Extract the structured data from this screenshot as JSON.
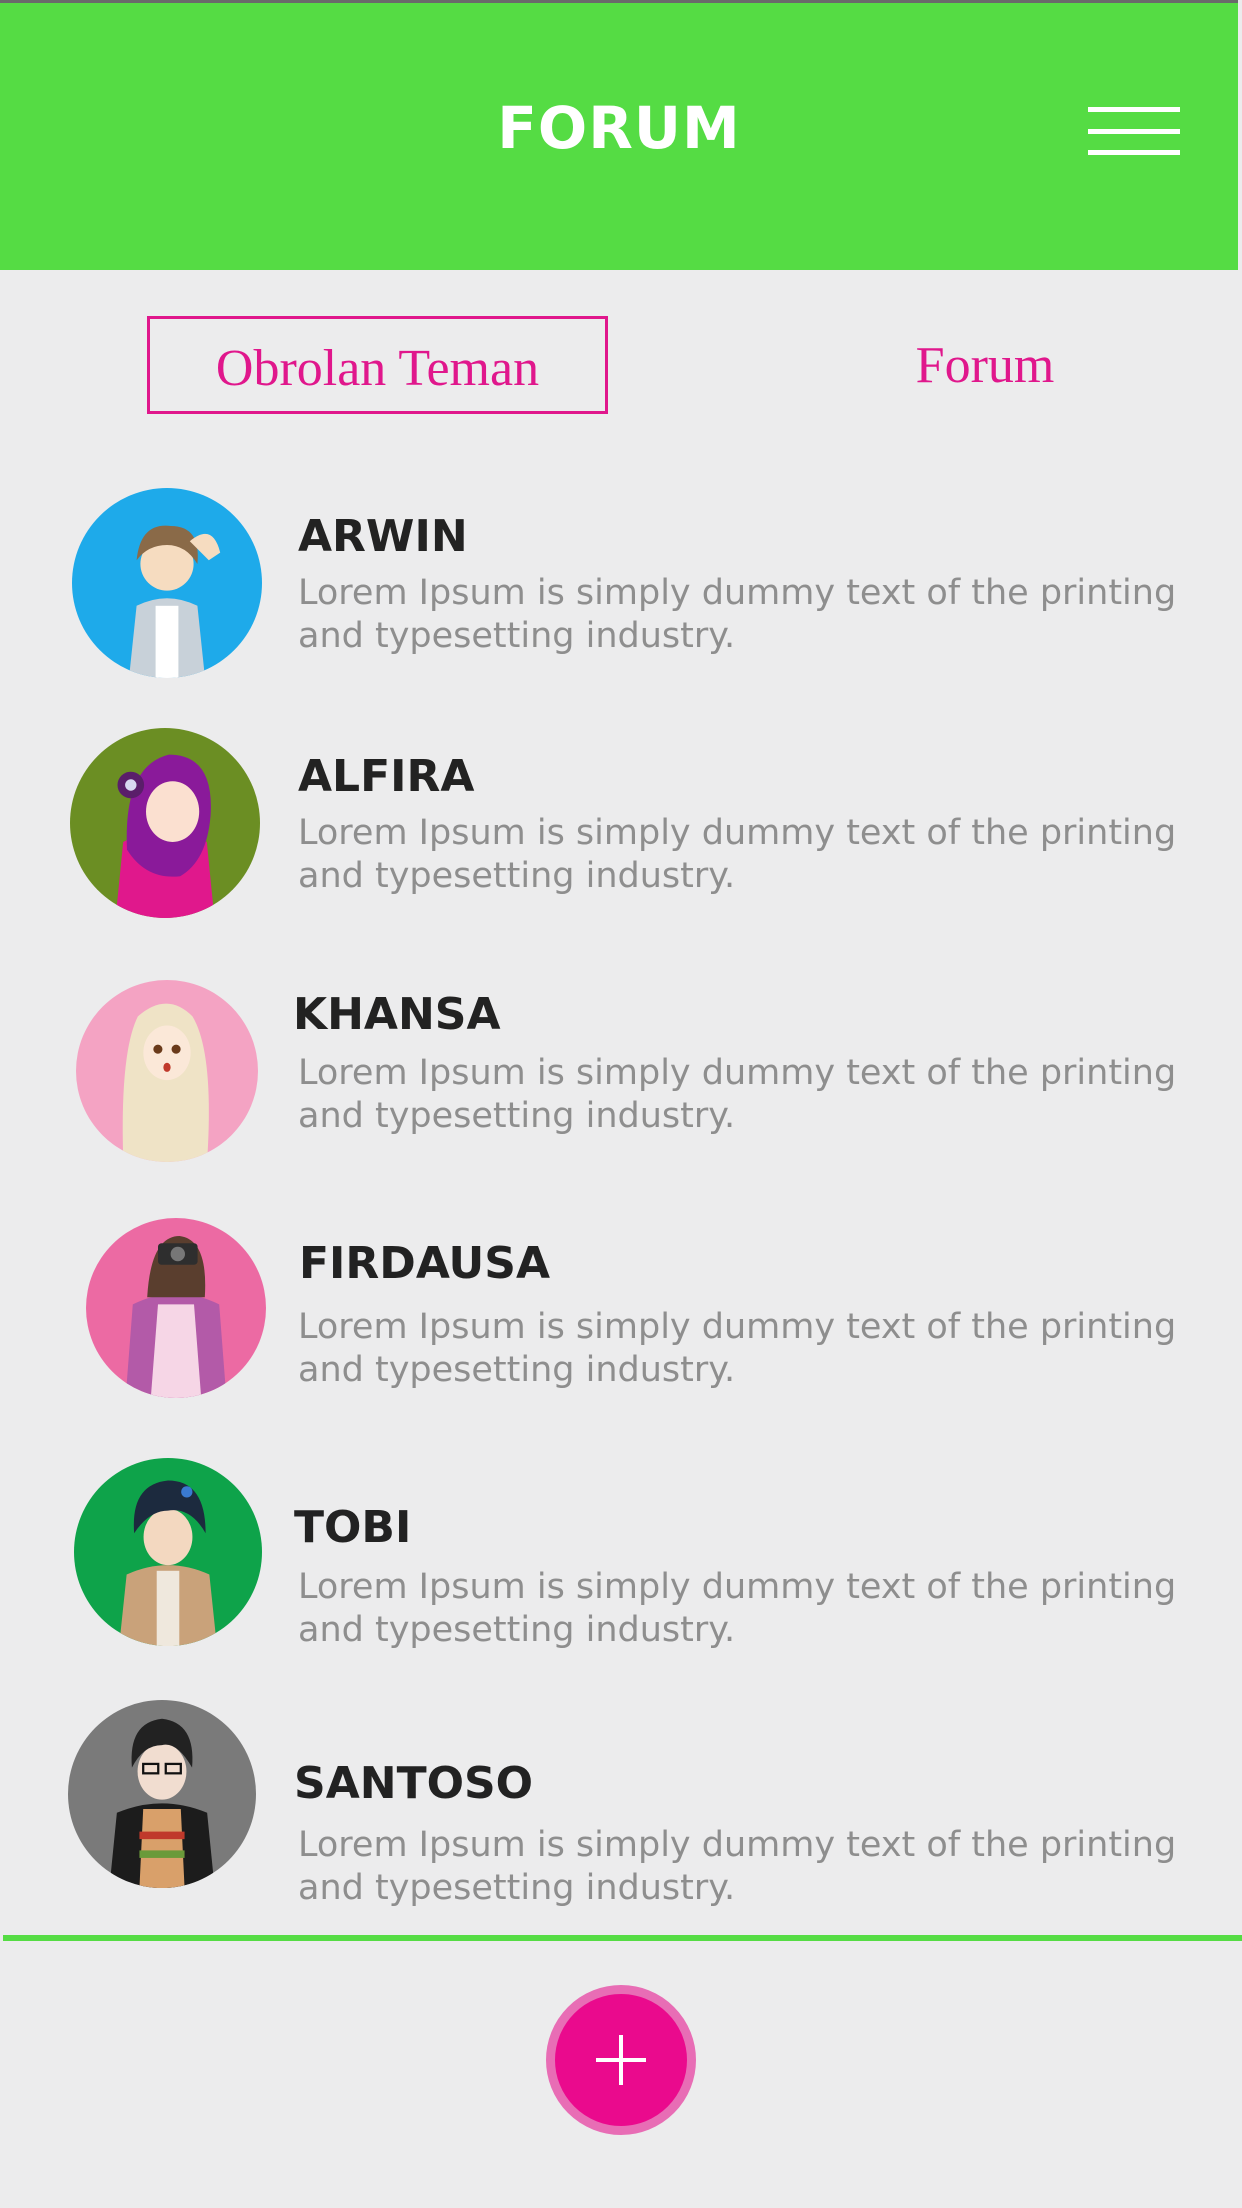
{
  "header": {
    "title": "FORUM",
    "menu_icon": "hamburger-menu-icon"
  },
  "tabs": [
    {
      "label": "Obrolan Teman",
      "active": true
    },
    {
      "label": "Forum",
      "active": false
    }
  ],
  "colors": {
    "header": "#55dc44",
    "accent": "#e0178c",
    "fab": "#ea0a8d",
    "background": "#ececed"
  },
  "conversations": [
    {
      "name": "ARWIN",
      "message": "Lorem Ipsum is simply dummy text of the printing and typesetting industry.",
      "avatar_bg": "#1eaaea"
    },
    {
      "name": "ALFIRA",
      "message": "Lorem Ipsum is simply dummy text of the printing and typesetting industry.",
      "avatar_bg": "#6b8e23"
    },
    {
      "name": "KHANSA",
      "message": "Lorem Ipsum is simply dummy text of the printing and typesetting industry.",
      "avatar_bg": "#f4a3c3"
    },
    {
      "name": "FIRDAUSA",
      "message": "Lorem Ipsum is simply dummy text of the printing and typesetting industry.",
      "avatar_bg": "#ec6aa3"
    },
    {
      "name": "TOBI",
      "message": "Lorem Ipsum is simply dummy text of the printing and typesetting industry.",
      "avatar_bg": "#0ea34a"
    },
    {
      "name": "SANTOSO",
      "message": "Lorem Ipsum is simply dummy text of the printing and typesetting industry.",
      "avatar_bg": "#7a7a7a"
    }
  ],
  "fab": {
    "icon": "plus-icon"
  }
}
